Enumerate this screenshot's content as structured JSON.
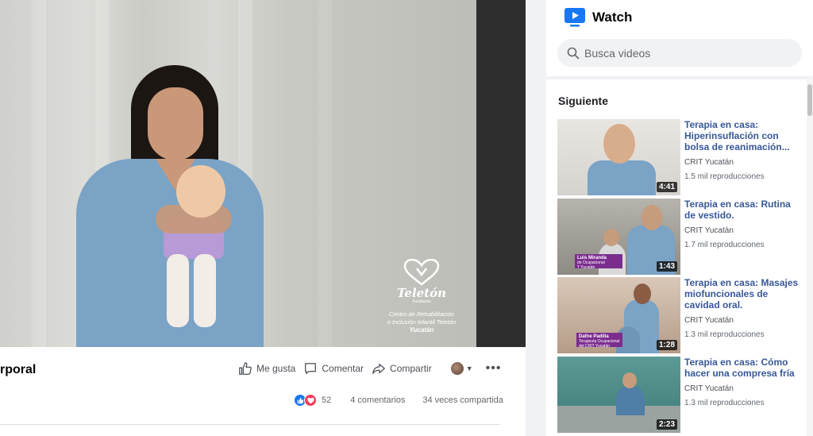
{
  "video": {
    "title": "rporal",
    "logo": {
      "name": "Teletón",
      "sub": "Fundación",
      "line1": "Centro de Rehabilitación",
      "line2": "e Inclusión Infantil Teletón",
      "city": "Yucatán"
    },
    "actions": {
      "like": "Me gusta",
      "comment": "Comentar",
      "share": "Compartir"
    },
    "stats": {
      "reactions": "52",
      "comments": "4 comentarios",
      "shares": "34 veces compartida"
    }
  },
  "watch": {
    "title": "Watch",
    "search_placeholder": "Busca videos",
    "next_label": "Siguiente",
    "videos": [
      {
        "title": "Terapia en casa: Hiperinsuflación con bolsa de reanimación...",
        "channel": "CRIT Yucatán",
        "views": "1.5 mil reproducciones",
        "duration": "4:41"
      },
      {
        "title": "Terapia en casa: Rutina de vestido.",
        "channel": "CRIT Yucatán",
        "views": "1.7 mil reproducciones",
        "duration": "1:43",
        "caption_name": "Luis Miranda",
        "caption_role": "de Ocupacional",
        "caption_org": "T Yucatán"
      },
      {
        "title": "Terapia en casa: Masajes miofuncionales de cavidad oral.",
        "channel": "CRIT Yucatán",
        "views": "1.3 mil reproducciones",
        "duration": "1:28",
        "caption_name": "Dafne Padilla",
        "caption_role": "Terapeuta Ocupacional",
        "caption_org": "del CRIT Yucatán"
      },
      {
        "title": "Terapia en casa: Cómo hacer una compresa fría",
        "channel": "CRIT Yucatán",
        "views": "1.3 mil reproducciones",
        "duration": "2:23"
      }
    ]
  },
  "colors": {
    "link_blue": "#385898",
    "like_blue": "#1877f2",
    "love_red": "#f33e58",
    "watch_blue": "#1877f2"
  }
}
